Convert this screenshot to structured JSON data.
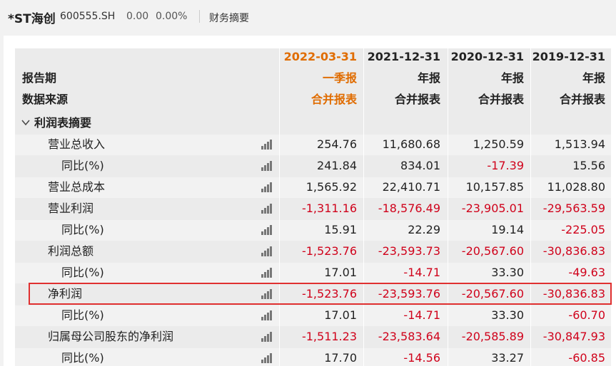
{
  "stock": {
    "name": "*ST海创",
    "code": "600555.SH",
    "change": "0.00",
    "change_pct": "0.00%"
  },
  "tabs": {
    "active": "财务摘要"
  },
  "header": {
    "labels": [
      "报告期",
      "数据来源"
    ],
    "periods": [
      {
        "date": "2022-03-31",
        "type": "一季报",
        "source": "合并报表"
      },
      {
        "date": "2021-12-31",
        "type": "年报",
        "source": "合并报表"
      },
      {
        "date": "2020-12-31",
        "type": "年报",
        "source": "合并报表"
      },
      {
        "date": "2019-12-31",
        "type": "年报",
        "source": "合并报表"
      }
    ]
  },
  "section": {
    "title": "利润表摘要"
  },
  "rows": [
    {
      "label": "营业总收入",
      "indent": 1,
      "values": [
        "254.76",
        "11,680.68",
        "1,250.59",
        "1,513.94"
      ]
    },
    {
      "label": "同比(%)",
      "indent": 2,
      "values": [
        "241.84",
        "834.01",
        "-17.39",
        "15.56"
      ]
    },
    {
      "label": "营业总成本",
      "indent": 1,
      "values": [
        "1,565.92",
        "22,410.71",
        "10,157.85",
        "11,028.80"
      ]
    },
    {
      "label": "营业利润",
      "indent": 1,
      "values": [
        "-1,311.16",
        "-18,576.49",
        "-23,905.01",
        "-29,563.59"
      ]
    },
    {
      "label": "同比(%)",
      "indent": 2,
      "values": [
        "15.91",
        "22.29",
        "19.14",
        "-225.05"
      ]
    },
    {
      "label": "利润总额",
      "indent": 1,
      "values": [
        "-1,523.76",
        "-23,593.73",
        "-20,567.60",
        "-30,836.83"
      ]
    },
    {
      "label": "同比(%)",
      "indent": 2,
      "values": [
        "17.01",
        "-14.71",
        "33.30",
        "-49.63"
      ]
    },
    {
      "label": "净利润",
      "indent": 1,
      "values": [
        "-1,523.76",
        "-23,593.76",
        "-20,567.60",
        "-30,836.83"
      ],
      "highlighted": true
    },
    {
      "label": "同比(%)",
      "indent": 2,
      "values": [
        "17.01",
        "-14.71",
        "33.30",
        "-60.70"
      ]
    },
    {
      "label": "归属母公司股东的净利润",
      "indent": 1,
      "values": [
        "-1,511.23",
        "-23,583.64",
        "-20,585.89",
        "-30,847.93"
      ]
    },
    {
      "label": "同比(%)",
      "indent": 2,
      "values": [
        "17.70",
        "-14.56",
        "33.27",
        "-60.85"
      ]
    }
  ],
  "colors": {
    "highlight_border": "#e03030",
    "negative": "#d0021b",
    "current_period": "#e06c00"
  },
  "icons": {
    "row_chart": "bar-chart-icon",
    "section_toggle": "chevron-down-icon"
  }
}
